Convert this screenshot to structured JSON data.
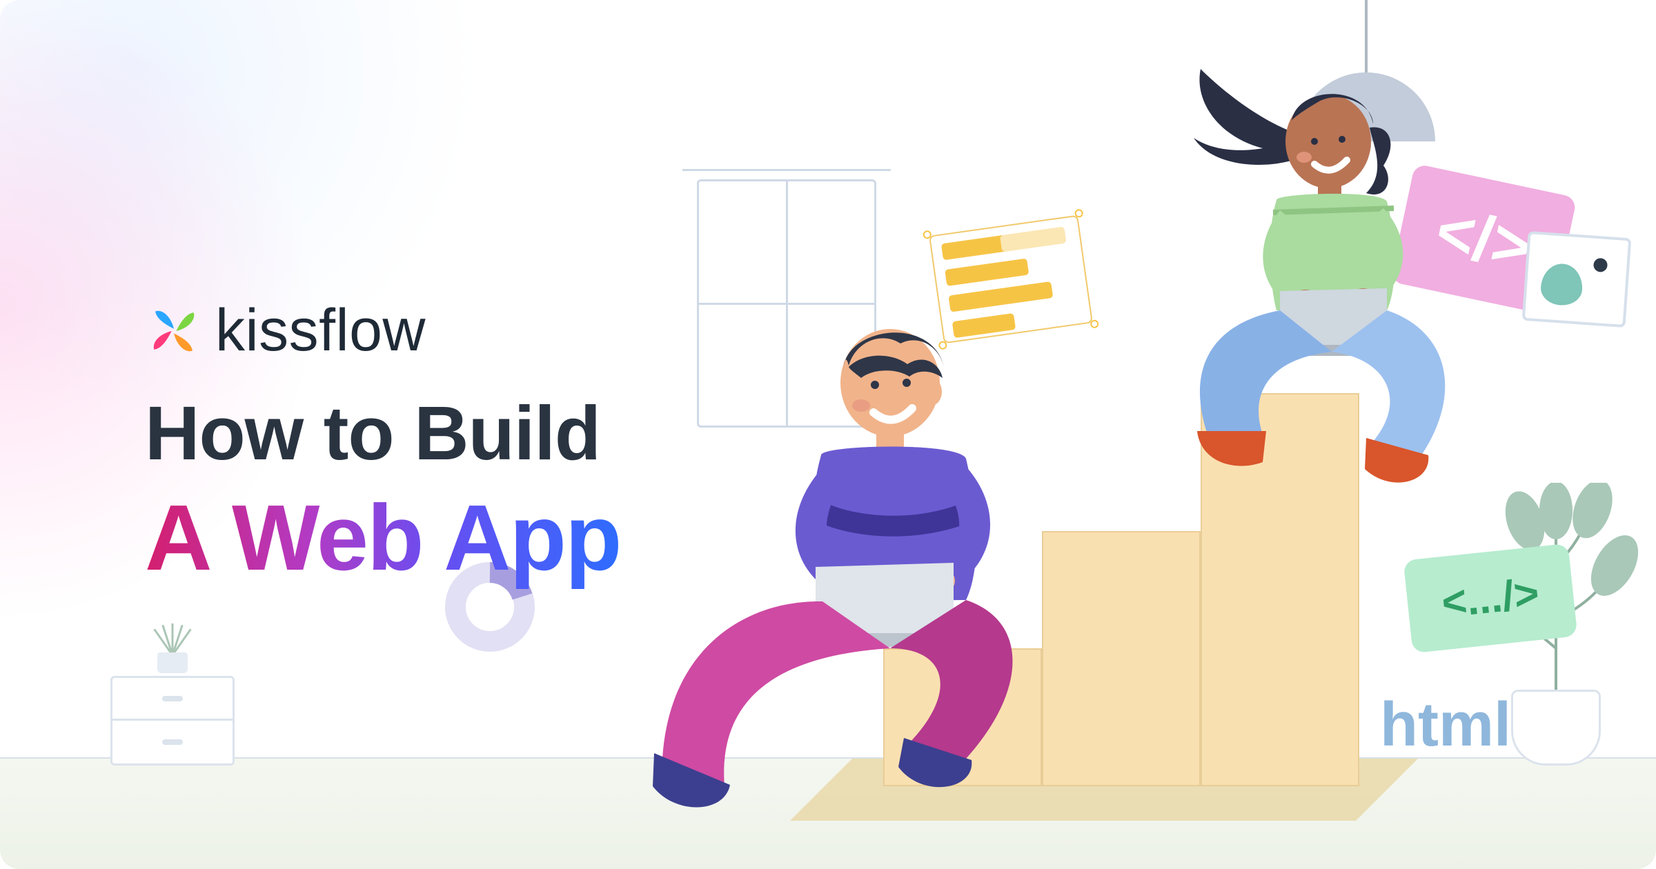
{
  "brand": {
    "name": "kissflow"
  },
  "heading": {
    "line1": "How to Build",
    "line2": "A Web App"
  },
  "labels": {
    "html": "html",
    "code_short": "</>",
    "code_long": "<.../>"
  },
  "colors": {
    "gradient_start": "#d41f6e",
    "gradient_end": "#2e6cff",
    "bar": "#f9e0b1",
    "pink_card": "#f1aee0",
    "green_card": "#b7eccf"
  }
}
